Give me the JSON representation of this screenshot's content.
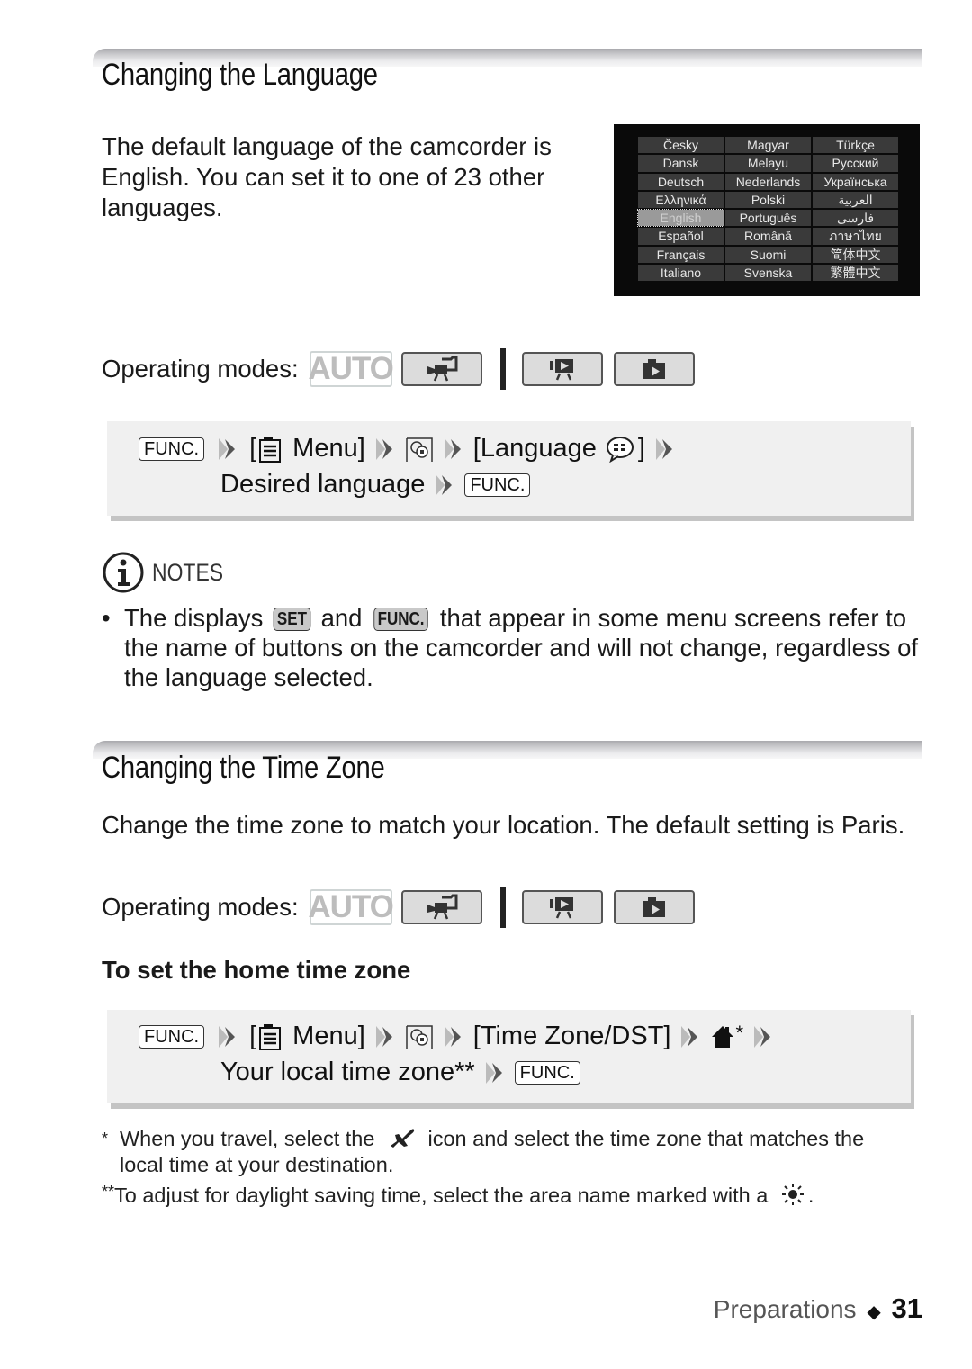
{
  "section1": {
    "title": "Changing the Language",
    "intro": "The default language of the camcorder is English. You can set it to one of 23 other languages.",
    "language_screen": {
      "columns": [
        [
          "Česky",
          "Dansk",
          "Deutsch",
          "Ελληνικά",
          "English",
          "Español",
          "Français",
          "Italiano"
        ],
        [
          "Magyar",
          "Melayu",
          "Nederlands",
          "Polski",
          "Português",
          "Română",
          "Suomi",
          "Svenska"
        ],
        [
          "Türkçe",
          "Русский",
          "Українська",
          "العربية",
          "فارسی",
          "ภาษาไทย",
          "简体中文",
          "繁體中文"
        ]
      ],
      "selected": "English"
    },
    "operating_modes": {
      "label": "Operating modes:",
      "auto_label": "AUTO",
      "modes": [
        "auto",
        "camcorder-record",
        "movie-playback",
        "photo-playback"
      ]
    },
    "procedure": {
      "func_key": "FUNC.",
      "open_bracket": "[",
      "close_bracket": "]",
      "menu_label": "Menu]",
      "language_label": "[Language",
      "desired": "Desired language",
      "func_key_end": "FUNC."
    },
    "notes": {
      "heading": "NOTES",
      "bullet": "•",
      "text_before": "The displays",
      "set_key": "SET",
      "and": "and",
      "func_key": "FUNC.",
      "text_after": "that appear in some menu screens refer to the name of buttons on the camcorder and will not change, regardless of the language selected."
    }
  },
  "section2": {
    "title": "Changing the Time Zone",
    "intro": "Change the time zone to match your location. The default setting is Paris.",
    "operating_modes": {
      "label": "Operating modes:",
      "auto_label": "AUTO"
    },
    "subheading": "To set the home time zone",
    "procedure": {
      "func_key": "FUNC.",
      "open_bracket": "[",
      "menu_label": "Menu]",
      "time_zone_label": "[Time Zone/DST]",
      "asterisk": "*",
      "local": "Your local time zone**",
      "func_key_end": "FUNC."
    },
    "footnotes": {
      "fn1_mark": "*",
      "fn1_before": "When you travel, select the",
      "fn1_after": "icon and select the time zone that matches the local time at your destination.",
      "fn2_mark": "**",
      "fn2_text": "To adjust for daylight saving time, select the area name marked with a",
      "fn2_end": "."
    }
  },
  "footer": {
    "section": "Preparations",
    "diamond": "◆",
    "page": "31"
  }
}
